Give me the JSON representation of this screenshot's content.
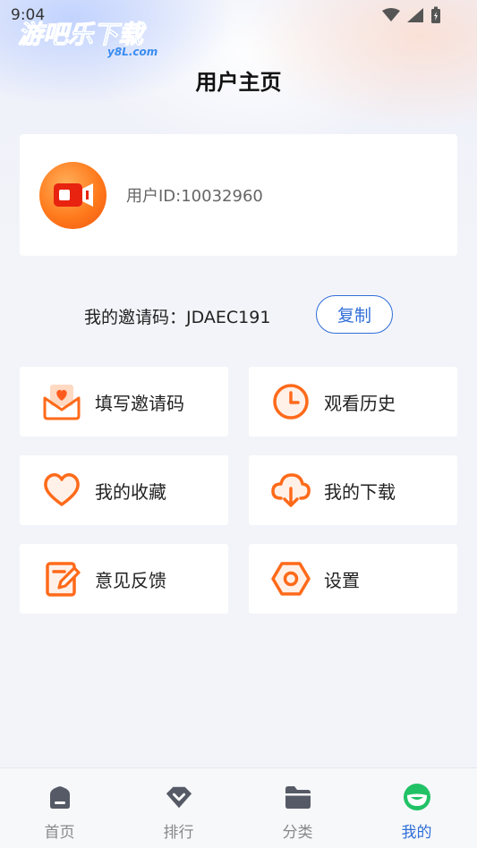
{
  "status_bar": {
    "time": "9:04"
  },
  "watermark": {
    "cn": "游吧乐下载",
    "en": "y8L.com"
  },
  "header": {
    "title": "用户主页"
  },
  "profile": {
    "user_id": "用户ID:10032960"
  },
  "invite": {
    "text": "我的邀请码：JDAEC191",
    "copy_label": "复制"
  },
  "menu": [
    {
      "label": "填写邀请码",
      "icon": "envelope-heart-icon"
    },
    {
      "label": "观看历史",
      "icon": "clock-icon"
    },
    {
      "label": "我的收藏",
      "icon": "heart-icon"
    },
    {
      "label": "我的下载",
      "icon": "cloud-download-icon"
    },
    {
      "label": "意见反馈",
      "icon": "edit-note-icon"
    },
    {
      "label": "设置",
      "icon": "hexagon-settings-icon"
    }
  ],
  "tabs": [
    {
      "label": "首页",
      "icon": "home-icon"
    },
    {
      "label": "排行",
      "icon": "diamond-rank-icon"
    },
    {
      "label": "分类",
      "icon": "folder-icon"
    },
    {
      "label": "我的",
      "icon": "smile-face-icon",
      "active": true
    }
  ],
  "colors": {
    "accent_orange": "#ff6a1a",
    "accent_blue": "#2f6ed8",
    "tab_inactive": "#888888"
  }
}
